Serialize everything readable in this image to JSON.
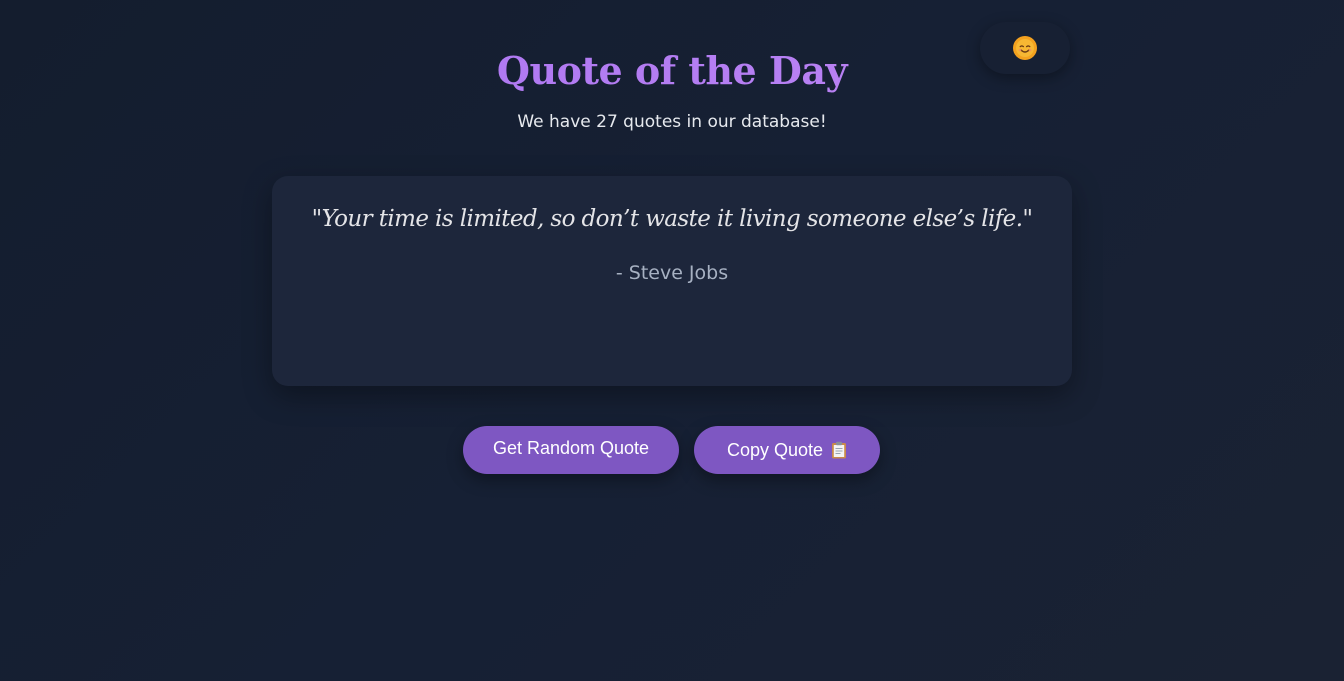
{
  "header": {
    "title": "Quote of the Day",
    "subtitle": "We have 27 quotes in our database!"
  },
  "theme_toggle": {
    "icon": "sun-face-icon"
  },
  "quote": {
    "text": "\"Your time is limited, so don’t waste it living someone else’s life.\"",
    "author": "- Steve Jobs"
  },
  "actions": {
    "random_label": "Get Random Quote",
    "copy_label": "Copy Quote",
    "copy_icon": "clipboard-icon"
  },
  "colors": {
    "accent": "#7e57c2",
    "title": "#b07ef0",
    "card": "#1d263b",
    "background": "#141d2e"
  }
}
